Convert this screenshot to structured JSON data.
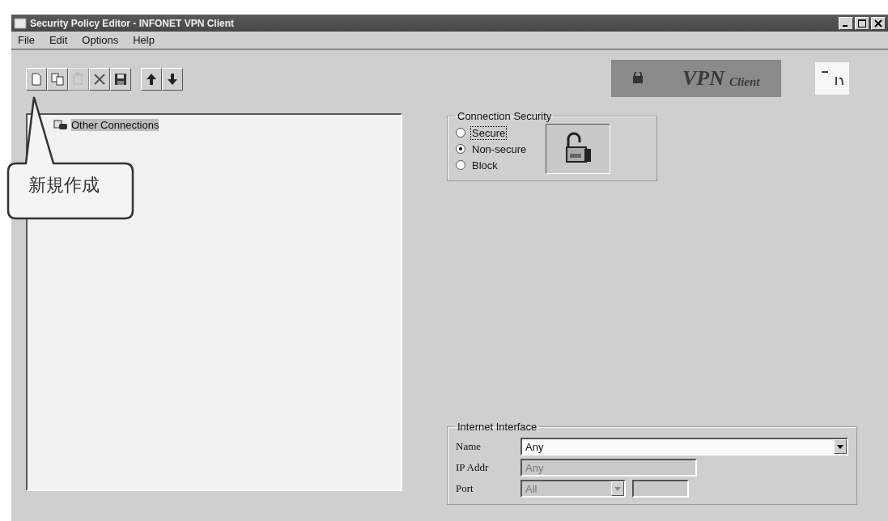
{
  "window": {
    "title": "Security Policy Editor - INFONET VPN Client"
  },
  "menu": [
    {
      "label": "File"
    },
    {
      "label": "Edit"
    },
    {
      "label": "Options"
    },
    {
      "label": "Help"
    }
  ],
  "toolbar": [
    {
      "kind": "new",
      "disabled": false
    },
    {
      "kind": "copy",
      "disabled": false
    },
    {
      "kind": "paste",
      "disabled": true
    },
    {
      "kind": "delete",
      "disabled": false
    },
    {
      "kind": "save",
      "disabled": false
    },
    {
      "kind": "up",
      "disabled": false
    },
    {
      "kind": "down",
      "disabled": false
    }
  ],
  "logo": {
    "main": "VPN",
    "sub": "Client"
  },
  "tree": {
    "items": [
      {
        "label": "Other Connections",
        "selected": true
      }
    ]
  },
  "connection_security": {
    "title": "Connection Security",
    "options": [
      {
        "label": "Secure",
        "selected": false,
        "focused": true
      },
      {
        "label": "Non-secure",
        "selected": true,
        "focused": false
      },
      {
        "label": "Block",
        "selected": false,
        "focused": false
      }
    ]
  },
  "internet_interface": {
    "title": "Internet Interface",
    "name": {
      "label": "Name",
      "value": "Any",
      "disabled": false
    },
    "ip_addr": {
      "label": "IP Addr",
      "value": "Any",
      "disabled": true
    },
    "port": {
      "label": "Port",
      "value": "All",
      "disabled": true
    }
  },
  "callout": {
    "text": "新規作成"
  }
}
